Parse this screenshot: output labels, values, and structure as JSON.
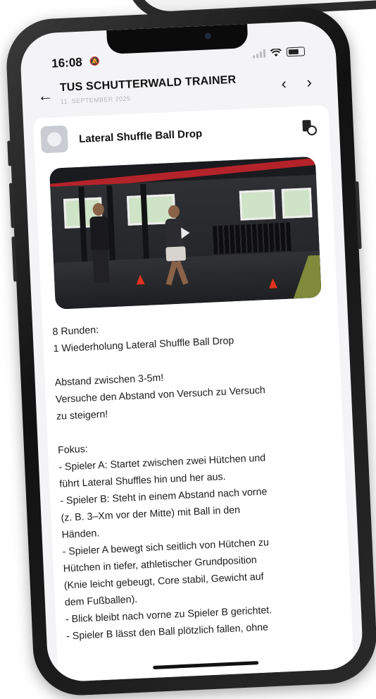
{
  "status_bar": {
    "time": "16:08",
    "mute_glyph": "🔕",
    "icons": [
      "signal-icon",
      "wifi-icon",
      "battery-icon"
    ]
  },
  "header": {
    "back_glyph": "←",
    "title": "TUS SCHUTTERWALD TRAINER",
    "date": "11. SEPTEMBER 2025",
    "prev_glyph": "‹",
    "next_glyph": "›"
  },
  "exercise": {
    "title": "Lateral Shuffle Ball Drop",
    "description_lines": [
      "8 Runden:",
      "1 Wiederholung Lateral Shuffle Ball Drop",
      "",
      "Abstand zwischen 3-5m!",
      "Versuche den Abstand von Versuch zu Versuch",
      "zu steigern!",
      "",
      "Fokus:",
      "- Spieler A: Startet zwischen zwei Hütchen und",
      "führt Lateral Shuffles hin und her aus.",
      "- Spieler B: Steht in einem Abstand nach vorne",
      "(z. B. 3–Xm vor der Mitte) mit Ball in den",
      "Händen.",
      "- Spieler A bewegt sich seitlich von Hütchen zu",
      "Hütchen in tiefer, athletischer Grundposition",
      "(Knie leicht gebeugt, Core stabil, Gewicht auf",
      "dem Fußballen).",
      "- Blick bleibt nach vorne zu Spieler B gerichtet.",
      "- Spieler B lässt den Ball plötzlich fallen, ohne"
    ]
  },
  "colors": {
    "screen_bg": "#f4f4f6",
    "card_bg": "#ffffff",
    "date_text": "#b7b7b7",
    "cone": "#e0321f",
    "gym_stripe": "#b5232a"
  }
}
